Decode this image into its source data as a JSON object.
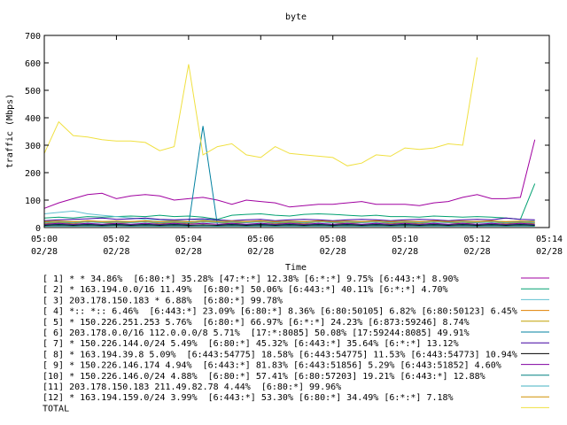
{
  "chart_data": {
    "type": "line",
    "title": "byte",
    "xlabel": "Time",
    "ylabel": "traffic (Mbps)",
    "ylim": [
      0,
      700
    ],
    "yticks": [
      0,
      100,
      200,
      300,
      400,
      500,
      600,
      700
    ],
    "xlim": [
      0,
      14
    ],
    "xticks": [
      {
        "pos": 0,
        "line1": "05:00",
        "line2": "02/28"
      },
      {
        "pos": 2,
        "line1": "05:02",
        "line2": "02/28"
      },
      {
        "pos": 4,
        "line1": "05:04",
        "line2": "02/28"
      },
      {
        "pos": 6,
        "line1": "05:06",
        "line2": "02/28"
      },
      {
        "pos": 8,
        "line1": "05:08",
        "line2": "02/28"
      },
      {
        "pos": 10,
        "line1": "05:10",
        "line2": "02/28"
      },
      {
        "pos": 12,
        "line1": "05:12",
        "line2": "02/28"
      },
      {
        "pos": 14,
        "line1": "05:14",
        "line2": "02/28"
      }
    ],
    "x": [
      0,
      0.4,
      0.8,
      1.2,
      1.6,
      2.0,
      2.4,
      2.8,
      3.2,
      3.6,
      4.0,
      4.4,
      4.8,
      5.2,
      5.6,
      6.0,
      6.4,
      6.8,
      7.2,
      7.6,
      8.0,
      8.4,
      8.8,
      9.2,
      9.6,
      10.0,
      10.4,
      10.8,
      11.2,
      11.6,
      12.0,
      12.4,
      12.8,
      13.2,
      13.6
    ],
    "legend": {
      "position": "below"
    },
    "series": [
      {
        "name": "[ 1] * * 34.86%  [6:80:*] 35.28% [47:*:*] 12.38% [6:*:*] 9.75% [6:443:*] 8.90%",
        "color": "#a000a0",
        "values": [
          70,
          90,
          105,
          120,
          125,
          105,
          115,
          120,
          115,
          100,
          105,
          110,
          100,
          85,
          100,
          95,
          90,
          75,
          80,
          85,
          85,
          90,
          95,
          85,
          85,
          85,
          80,
          90,
          95,
          110,
          120,
          105,
          105,
          110,
          320
        ]
      },
      {
        "name": "[ 2] * 163.194.0.0/16 11.49%  [6:80:*] 50.06% [6:443:*] 40.11% [6:*:*] 4.70%",
        "color": "#00a070",
        "values": [
          35,
          38,
          35,
          40,
          38,
          40,
          42,
          40,
          45,
          40,
          42,
          38,
          30,
          45,
          48,
          50,
          45,
          42,
          48,
          50,
          48,
          45,
          42,
          45,
          40,
          40,
          38,
          42,
          40,
          38,
          40,
          38,
          35,
          30,
          160
        ]
      },
      {
        "name": "[ 3] 203.178.150.183 * 6.88%  [6:80:*] 99.78%",
        "color": "#60c0d0",
        "values": [
          50,
          55,
          60,
          50,
          45,
          40,
          35,
          30,
          28,
          25,
          30,
          28,
          25,
          20,
          22,
          20,
          18,
          20,
          22,
          20,
          18,
          22,
          20,
          18,
          20,
          22,
          20,
          18,
          20,
          22,
          20,
          18,
          20,
          22,
          25
        ]
      },
      {
        "name": "[ 4] *:: *:: 6.46%  [6:443:*] 23.09% [6:80:*] 8.36% [6:80:50105] 6.82% [6:80:50123] 6.45%",
        "color": "#e08000",
        "values": [
          20,
          22,
          20,
          25,
          22,
          20,
          22,
          25,
          20,
          22,
          20,
          25,
          22,
          20,
          22,
          25,
          20,
          22,
          20,
          25,
          22,
          20,
          22,
          25,
          20,
          22,
          20,
          25,
          22,
          20,
          22,
          25,
          20,
          22,
          18
        ]
      },
      {
        "name": "[ 5] * 150.226.251.253 5.76%  [6:80:*] 66.97% [6:*:*] 24.23% [6:873:59246] 8.74%",
        "color": "#c0a000",
        "values": [
          15,
          18,
          15,
          20,
          18,
          15,
          18,
          20,
          15,
          18,
          15,
          20,
          18,
          15,
          18,
          20,
          15,
          18,
          15,
          20,
          18,
          15,
          18,
          20,
          15,
          18,
          15,
          20,
          18,
          15,
          18,
          20,
          15,
          18,
          15
        ]
      },
      {
        "name": "[ 6] 203.178.0.0/16 112.0.0.0/8 5.71%  [17:*:8085] 50.08% [17:59244:8085] 49.91%",
        "color": "#0080a0",
        "values": [
          10,
          12,
          10,
          12,
          10,
          12,
          10,
          12,
          10,
          12,
          10,
          370,
          10,
          12,
          10,
          12,
          10,
          12,
          10,
          12,
          10,
          12,
          10,
          12,
          10,
          12,
          10,
          12,
          10,
          12,
          10,
          12,
          10,
          12,
          10
        ]
      },
      {
        "name": "[ 7] * 150.226.144.0/24 5.49%  [6:80:*] 45.32% [6:443:*] 35.64% [6:*:*] 13.12%",
        "color": "#4000a0",
        "values": [
          25,
          28,
          30,
          32,
          35,
          30,
          32,
          35,
          30,
          28,
          30,
          32,
          28,
          25,
          28,
          30,
          25,
          28,
          30,
          28,
          25,
          28,
          30,
          28,
          25,
          28,
          30,
          28,
          25,
          28,
          30,
          28,
          35,
          30,
          28
        ]
      },
      {
        "name": "[ 8] * 163.194.39.8 5.09%  [6:443:54775] 18.58% [6:443:54775] 11.53% [6:443:54773] 10.94%",
        "color": "#000000",
        "values": [
          8,
          10,
          8,
          10,
          8,
          10,
          8,
          10,
          8,
          10,
          8,
          10,
          8,
          10,
          8,
          10,
          8,
          10,
          8,
          10,
          8,
          10,
          8,
          10,
          8,
          10,
          8,
          10,
          8,
          10,
          8,
          10,
          8,
          10,
          8
        ]
      },
      {
        "name": "[ 9] * 150.226.146.174 4.94%  [6:443:*] 81.83% [6:443:51856] 5.29% [6:443:51852] 4.60%",
        "color": "#8000a0",
        "values": [
          12,
          15,
          12,
          15,
          12,
          15,
          12,
          15,
          12,
          15,
          12,
          15,
          12,
          15,
          12,
          15,
          12,
          15,
          12,
          15,
          12,
          15,
          12,
          15,
          12,
          15,
          12,
          15,
          12,
          15,
          12,
          15,
          12,
          15,
          12
        ]
      },
      {
        "name": "[10] * 150.226.146.0/24 4.88%  [6:80:*] 57.41% [6:80:57203] 19.21% [6:443:*] 12.88%",
        "color": "#008080",
        "values": [
          5,
          6,
          5,
          6,
          5,
          6,
          5,
          6,
          5,
          6,
          5,
          6,
          5,
          6,
          5,
          6,
          5,
          6,
          5,
          6,
          5,
          6,
          5,
          6,
          5,
          6,
          5,
          6,
          5,
          6,
          5,
          6,
          5,
          6,
          5
        ]
      },
      {
        "name": "[11] 203.178.150.183 211.49.82.78 4.44%  [6:80:*] 99.96%",
        "color": "#40b0c0",
        "values": [
          18,
          20,
          18,
          20,
          18,
          20,
          18,
          20,
          18,
          20,
          18,
          20,
          18,
          20,
          18,
          20,
          18,
          20,
          18,
          20,
          18,
          20,
          18,
          20,
          18,
          20,
          18,
          20,
          18,
          20,
          18,
          20,
          18,
          20,
          18
        ]
      },
      {
        "name": "[12] * 163.194.159.0/24 3.99%  [6:443:*] 53.30% [6:80:*] 34.49% [6:*:*] 7.18%",
        "color": "#d09000",
        "values": [
          22,
          24,
          22,
          24,
          22,
          24,
          22,
          24,
          22,
          24,
          22,
          24,
          22,
          24,
          22,
          24,
          22,
          24,
          22,
          24,
          22,
          24,
          22,
          24,
          22,
          24,
          22,
          24,
          22,
          24,
          22,
          24,
          22,
          24,
          22
        ]
      },
      {
        "name": "TOTAL",
        "color": "#f0e040",
        "values": [
          270,
          385,
          335,
          330,
          320,
          315,
          315,
          310,
          280,
          295,
          595,
          265,
          295,
          305,
          265,
          255,
          295,
          270,
          265,
          260,
          255,
          225,
          235,
          265,
          260,
          290,
          285,
          290,
          305,
          300,
          620
        ]
      }
    ]
  }
}
